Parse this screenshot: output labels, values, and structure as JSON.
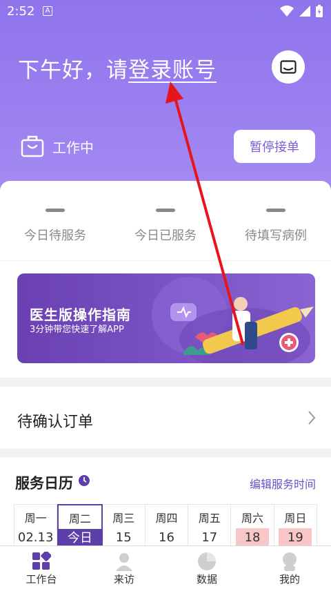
{
  "status_bar": {
    "time": "2:52",
    "badge": "A"
  },
  "header": {
    "greeting_prefix": "下午好，请",
    "login_link": "登录账号",
    "work_status": "工作中",
    "pause_button": "暂停接单"
  },
  "stats": [
    {
      "label": "今日待服务"
    },
    {
      "label": "今日已服务"
    },
    {
      "label": "待填写病例"
    }
  ],
  "banner": {
    "title": "医生版操作指南",
    "subtitle": "3分钟带您快速了解APP"
  },
  "pending_orders": {
    "label": "待确认订单"
  },
  "calendar": {
    "title": "服务日历",
    "edit_link": "编辑服务时间",
    "days": [
      {
        "name": "周一",
        "date": "02.13"
      },
      {
        "name": "周二",
        "date": "今日"
      },
      {
        "name": "周三",
        "date": "15"
      },
      {
        "name": "周四",
        "date": "16"
      },
      {
        "name": "周五",
        "date": "17"
      },
      {
        "name": "周六",
        "date": "18"
      },
      {
        "name": "周日",
        "date": "19"
      }
    ]
  },
  "tabbar": [
    {
      "label": "工作台",
      "icon": "grid-icon"
    },
    {
      "label": "来访",
      "icon": "user-icon"
    },
    {
      "label": "数据",
      "icon": "chart-icon"
    },
    {
      "label": "我的",
      "icon": "profile-icon"
    }
  ],
  "colors": {
    "accent": "#7b5ddb",
    "calendar_today": "#5c3fa8",
    "weekend": "#f8c6c6",
    "annotation_arrow": "#e8141c"
  }
}
